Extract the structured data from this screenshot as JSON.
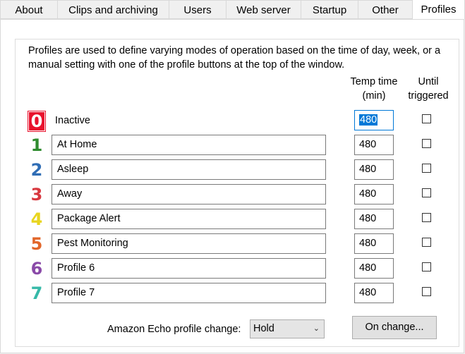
{
  "tabs": [
    "About",
    "Clips and archiving",
    "Users",
    "Web server",
    "Startup",
    "Other",
    "Profiles"
  ],
  "active_tab": "Profiles",
  "description": "Profiles are used to define varying modes of operation based on the time of day, week, or a manual setting with one of the profile buttons at the top of the window.",
  "headers": {
    "temp_time": "Temp time (min)",
    "until_triggered": "Until triggered"
  },
  "profiles": [
    {
      "number": "0",
      "name": "Inactive",
      "temp": "480",
      "color": "#ffffff",
      "until_triggered": false
    },
    {
      "number": "1",
      "name": "At Home",
      "temp": "480",
      "color": "#2e8b2e",
      "until_triggered": false
    },
    {
      "number": "2",
      "name": "Asleep",
      "temp": "480",
      "color": "#2f6db5",
      "until_triggered": false
    },
    {
      "number": "3",
      "name": "Away",
      "temp": "480",
      "color": "#d8383f",
      "until_triggered": false
    },
    {
      "number": "4",
      "name": "Package Alert",
      "temp": "480",
      "color": "#e8d51f",
      "until_triggered": false
    },
    {
      "number": "5",
      "name": "Pest Monitoring",
      "temp": "480",
      "color": "#e2662a",
      "until_triggered": false
    },
    {
      "number": "6",
      "name": "Profile 6",
      "temp": "480",
      "color": "#8a4aa8",
      "until_triggered": false
    },
    {
      "number": "7",
      "name": "Profile 7",
      "temp": "480",
      "color": "#36b9a8",
      "until_triggered": false
    }
  ],
  "echo": {
    "label": "Amazon Echo profile change:",
    "value": "Hold"
  },
  "on_change_button": "On change..."
}
